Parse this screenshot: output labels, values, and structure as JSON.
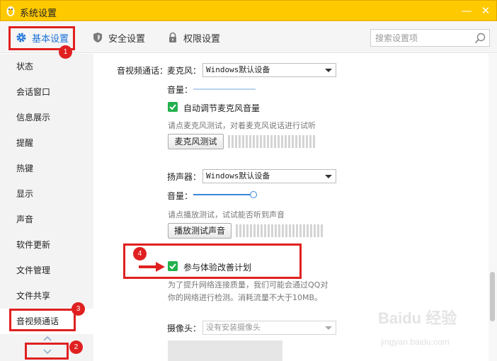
{
  "window": {
    "title": "系统设置",
    "minimize_glyph": "—",
    "close_glyph": "✕",
    "brand_color": "#ffc900"
  },
  "tabs": [
    {
      "label": "基本设置",
      "icon": "gear-icon",
      "active": true
    },
    {
      "label": "安全设置",
      "icon": "shield-icon",
      "active": false
    },
    {
      "label": "权限设置",
      "icon": "lock-icon",
      "active": false
    }
  ],
  "search": {
    "placeholder": "搜索设置项",
    "icon": "search-icon"
  },
  "sidebar": {
    "items": [
      {
        "label": "状态"
      },
      {
        "label": "会话窗口"
      },
      {
        "label": "信息展示"
      },
      {
        "label": "提醒"
      },
      {
        "label": "热键"
      },
      {
        "label": "显示"
      },
      {
        "label": "声音"
      },
      {
        "label": "软件更新"
      },
      {
        "label": "文件管理"
      },
      {
        "label": "文件共享"
      },
      {
        "label": "音视频通话",
        "active": true
      }
    ]
  },
  "av": {
    "section_label": "音视频通话：",
    "mic": {
      "label": "麦克风：",
      "device": "Windows默认设备",
      "volume_label": "音量：",
      "volume_level": 0,
      "auto_adjust_label": "自动调节麦克风音量",
      "auto_adjust_checked": true,
      "test_hint": "请点麦克风测试，对着麦克风说话进行试听",
      "test_button": "麦克风测试"
    },
    "speaker": {
      "label": "扬声器：",
      "device": "Windows默认设备",
      "volume_label": "音量：",
      "volume_level": 1.0,
      "test_hint": "请点播放测试，试试能否听到声音",
      "test_button": "播放测试声音"
    },
    "improve": {
      "label": "参与体验改善计划",
      "checked": true,
      "desc_line1": "为了提升网络连接质量，我们可能会通过QQ对",
      "desc_line2": "你的网络进行检测。消耗流量不大于10MB。"
    },
    "camera": {
      "label": "摄像头：",
      "device": "没有安装摄像头"
    }
  },
  "annotations": {
    "badge1": "1",
    "badge2": "2",
    "badge3": "3",
    "badge4": "4",
    "color": "#e02020"
  },
  "watermark": {
    "brand": "Baidu 经验",
    "url": "jingyan.baidu.com"
  }
}
